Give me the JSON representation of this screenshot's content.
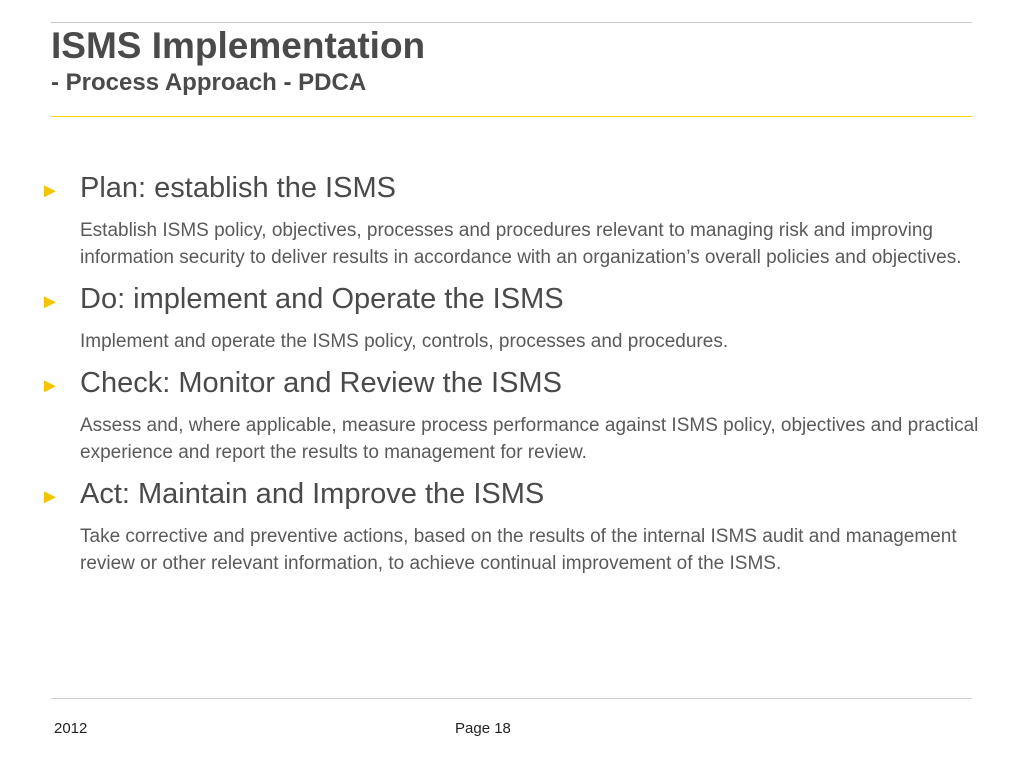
{
  "title": "ISMS Implementation",
  "subtitle": "- Process Approach - PDCA",
  "bullet_glyph": "►",
  "items": [
    {
      "heading": "Plan: establish the ISMS",
      "description": "Establish ISMS policy, objectives, processes and procedures relevant to managing risk and improving information security to deliver results in accordance with an organization’s overall policies and objectives."
    },
    {
      "heading": "Do: implement and Operate the ISMS",
      "description": "Implement and operate the ISMS policy, controls, processes and procedures."
    },
    {
      "heading": "Check: Monitor and Review the ISMS",
      "description": "Assess and, where applicable, measure process performance against ISMS policy, objectives and practical experience and report the results to management for review."
    },
    {
      "heading": "Act: Maintain and Improve the ISMS",
      "description": "Take corrective and preventive actions, based on the results of the internal ISMS audit and management review or other relevant information, to achieve continual improvement of the ISMS."
    }
  ],
  "footer": {
    "year": "2012",
    "page": "Page 18"
  },
  "colors": {
    "accent": "#f5c400",
    "title_text": "#4a4a4a",
    "body_text": "#5a5a5a"
  }
}
